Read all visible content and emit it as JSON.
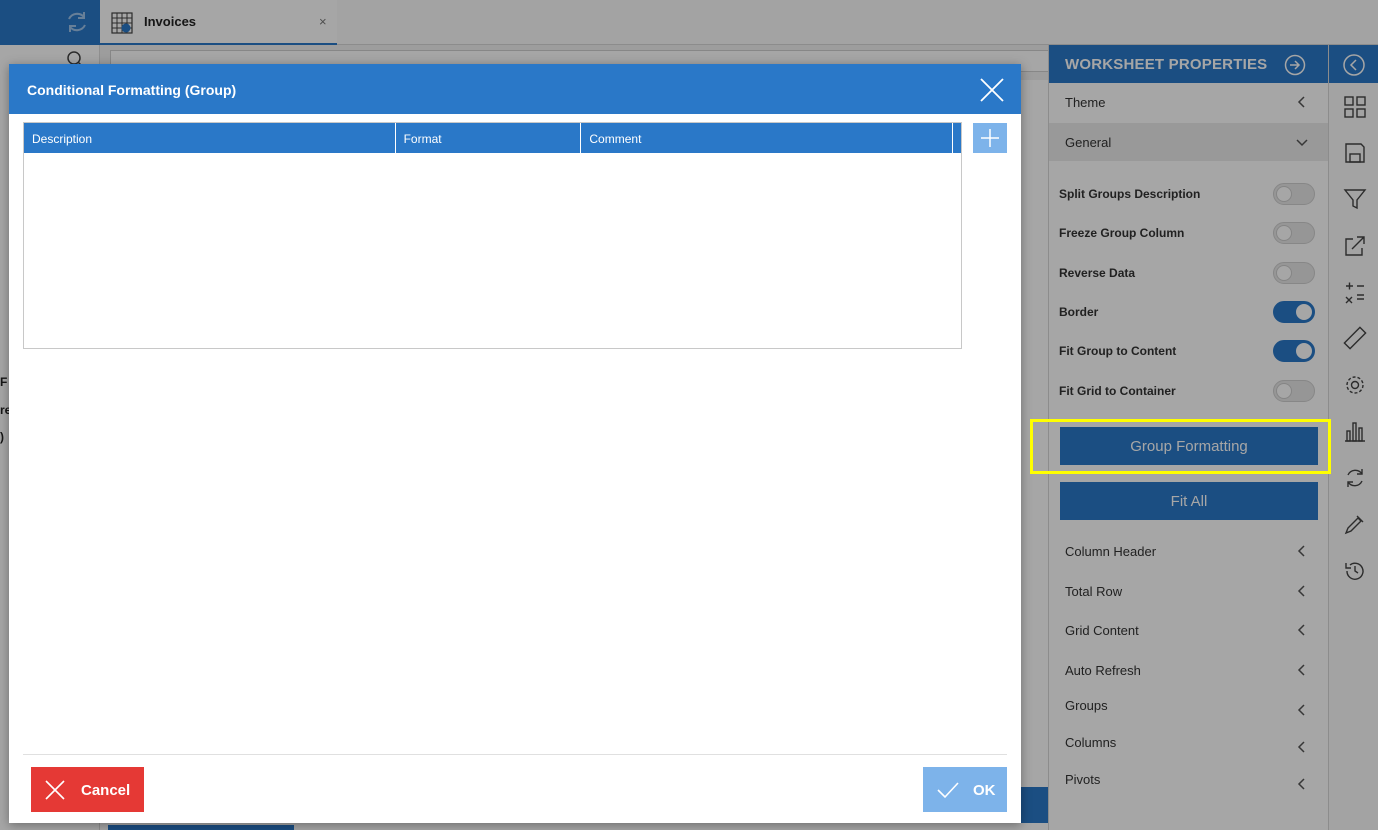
{
  "app": {
    "tab_title": "Invoices",
    "tab_close": "×"
  },
  "background_peek": [
    "F",
    "re",
    ")"
  ],
  "panel": {
    "title": "WORKSHEET PROPERTIES",
    "theme_label": "Theme",
    "general_label": "General",
    "toggles": [
      {
        "label": "Split Groups Description",
        "on": false
      },
      {
        "label": "Freeze Group Column",
        "on": false
      },
      {
        "label": "Reverse Data",
        "on": false
      },
      {
        "label": "Border",
        "on": true
      },
      {
        "label": "Fit Group to Content",
        "on": true
      },
      {
        "label": "Fit Grid to Container",
        "on": false
      }
    ],
    "group_formatting_button": "Group Formatting",
    "fit_all_button": "Fit All",
    "sections": [
      "Column Header",
      "Total Row",
      "Grid Content",
      "Auto Refresh",
      "Groups",
      "Columns",
      "Pivots"
    ]
  },
  "rail_icons": [
    "layout-grid-icon",
    "save-icon",
    "filter-icon",
    "export-icon",
    "calculator-icon",
    "ruler-icon",
    "gear-icon",
    "bar-chart-icon",
    "refresh-icon",
    "eyedropper-icon",
    "history-icon"
  ],
  "modal": {
    "title": "Conditional Formatting (Group)",
    "columns": [
      "Description",
      "Format",
      "Comment"
    ],
    "cancel_label": "Cancel",
    "ok_label": "OK"
  },
  "colors": {
    "accent": "#2a78c8",
    "accent_light": "#7db3ea",
    "danger": "#e53935",
    "highlight": "#ffff00"
  }
}
